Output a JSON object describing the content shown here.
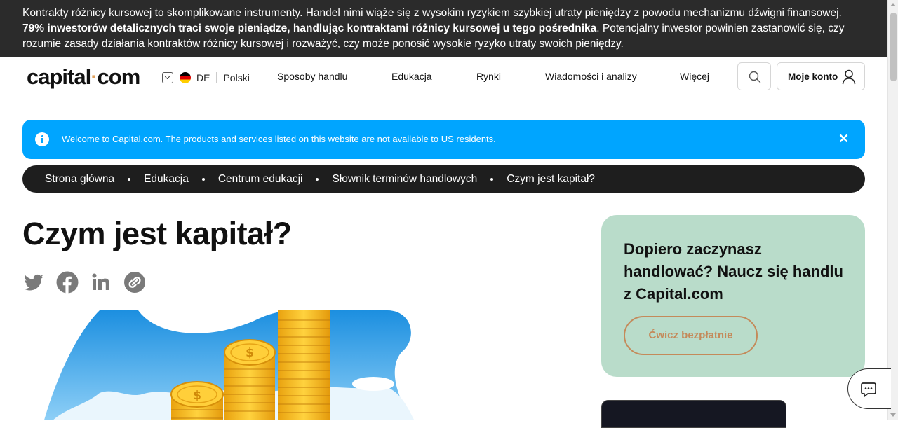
{
  "risk_banner": {
    "part1": "Kontrakty różnicy kursowej to skomplikowane instrumenty. Handel nimi wiąże się z wysokim ryzykiem szybkiej utraty pieniędzy z powodu mechanizmu dźwigni finansowej. ",
    "bold": "79% inwestorów detalicznych traci swoje pieniądze, handlując kontraktami różnicy kursowej u tego pośrednika",
    "part2": ". Potencjalny inwestor powinien zastanowić się, czy rozumie zasady działania kontraktów różnicy kursowej i rozważyć, czy może ponosić wysokie ryzyko utraty swoich pieniędzy."
  },
  "header": {
    "logo_left": "capital",
    "logo_dot": "·",
    "logo_right": "com",
    "lang_code": "DE",
    "lang_name": "Polski",
    "nav": [
      "Sposoby handlu",
      "Edukacja",
      "Rynki",
      "Wiadomości i analizy",
      "Więcej"
    ],
    "account_label": "Moje konto"
  },
  "notice": {
    "message": "Welcome to Capital.com. The products and services listed on this website are not available to US residents.",
    "close": "✕"
  },
  "breadcrumb": [
    "Strona główna",
    "Edukacja",
    "Centrum edukacji",
    "Słownik terminów handlowych",
    "Czym jest kapitał?"
  ],
  "article": {
    "title": "Czym jest kapitał?",
    "share_icons": [
      "twitter-icon",
      "facebook-icon",
      "linkedin-icon",
      "copy-link-icon"
    ]
  },
  "promo": {
    "title": "Dopiero zaczynasz handlować? Naucz się handlu z Capital.com",
    "button": "Ćwicz bezpłatnie"
  },
  "colors": {
    "banner_bg": "#2b2b2b",
    "notice_bg": "#00a5ff",
    "promo_bg": "#b9dcca",
    "accent": "#c48a5a"
  }
}
